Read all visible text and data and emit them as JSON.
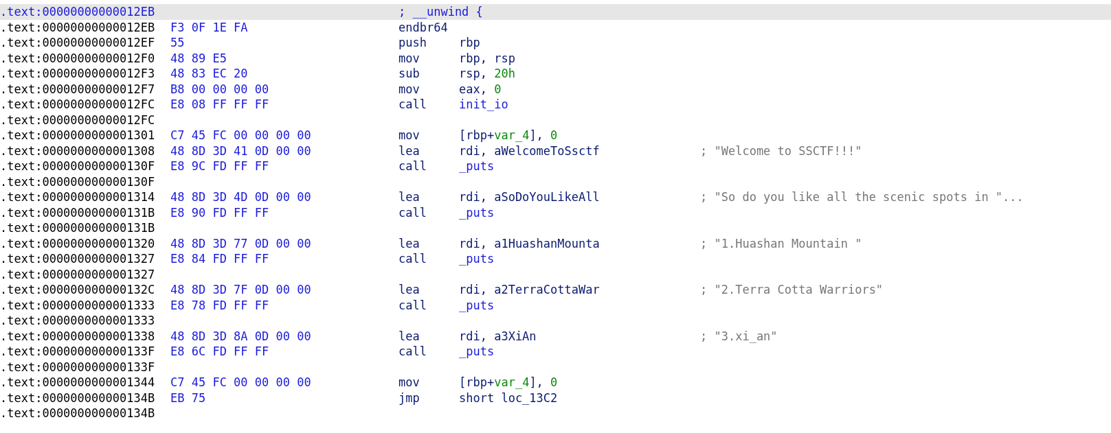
{
  "listing": [
    {
      "address": ".text:00000000000012EB",
      "selected": true,
      "directive": "; __unwind {"
    },
    {
      "address": ".text:00000000000012EB",
      "selected": false,
      "bytes": "F3 0F 1E FA",
      "mnemonic": "endbr64"
    },
    {
      "address": ".text:00000000000012EF",
      "selected": false,
      "bytes": "55",
      "mnemonic": "push",
      "operand": [
        {
          "text": "rbp",
          "kind": "plain"
        }
      ]
    },
    {
      "address": ".text:00000000000012F0",
      "selected": false,
      "bytes": "48 89 E5",
      "mnemonic": "mov",
      "operand": [
        {
          "text": "rbp, rsp",
          "kind": "plain"
        }
      ]
    },
    {
      "address": ".text:00000000000012F3",
      "selected": false,
      "bytes": "48 83 EC 20",
      "mnemonic": "sub",
      "operand": [
        {
          "text": "rsp, ",
          "kind": "plain"
        },
        {
          "text": "20h",
          "kind": "number"
        }
      ]
    },
    {
      "address": ".text:00000000000012F7",
      "selected": false,
      "bytes": "B8 00 00 00 00",
      "mnemonic": "mov",
      "operand": [
        {
          "text": "eax, ",
          "kind": "plain"
        },
        {
          "text": "0",
          "kind": "number"
        }
      ]
    },
    {
      "address": ".text:00000000000012FC",
      "selected": false,
      "bytes": "E8 08 FF FF FF",
      "mnemonic": "call",
      "operand": [
        {
          "text": "init_io",
          "kind": "name"
        }
      ]
    },
    {
      "address": ".text:00000000000012FC",
      "selected": false
    },
    {
      "address": ".text:0000000000001301",
      "selected": false,
      "bytes": "C7 45 FC 00 00 00 00",
      "mnemonic": "mov",
      "operand": [
        {
          "text": "[rbp+",
          "kind": "plain"
        },
        {
          "text": "var_4",
          "kind": "number"
        },
        {
          "text": "], ",
          "kind": "plain"
        },
        {
          "text": "0",
          "kind": "number"
        }
      ]
    },
    {
      "address": ".text:0000000000001308",
      "selected": false,
      "bytes": "48 8D 3D 41 0D 00 00",
      "mnemonic": "lea",
      "operand": [
        {
          "text": "rdi, aWelcomeToSsctf",
          "kind": "plain"
        }
      ],
      "comment": "; \"Welcome to SSCTF!!!\""
    },
    {
      "address": ".text:000000000000130F",
      "selected": false,
      "bytes": "E8 9C FD FF FF",
      "mnemonic": "call",
      "operand": [
        {
          "text": "_puts",
          "kind": "name"
        }
      ]
    },
    {
      "address": ".text:000000000000130F",
      "selected": false
    },
    {
      "address": ".text:0000000000001314",
      "selected": false,
      "bytes": "48 8D 3D 4D 0D 00 00",
      "mnemonic": "lea",
      "operand": [
        {
          "text": "rdi, aSoDoYouLikeAll",
          "kind": "plain"
        }
      ],
      "comment": "; \"So do you like all the scenic spots in \"..."
    },
    {
      "address": ".text:000000000000131B",
      "selected": false,
      "bytes": "E8 90 FD FF FF",
      "mnemonic": "call",
      "operand": [
        {
          "text": "_puts",
          "kind": "name"
        }
      ]
    },
    {
      "address": ".text:000000000000131B",
      "selected": false
    },
    {
      "address": ".text:0000000000001320",
      "selected": false,
      "bytes": "48 8D 3D 77 0D 00 00",
      "mnemonic": "lea",
      "operand": [
        {
          "text": "rdi, a1HuashanMounta",
          "kind": "plain"
        }
      ],
      "comment": "; \"1.Huashan Mountain \""
    },
    {
      "address": ".text:0000000000001327",
      "selected": false,
      "bytes": "E8 84 FD FF FF",
      "mnemonic": "call",
      "operand": [
        {
          "text": "_puts",
          "kind": "name"
        }
      ]
    },
    {
      "address": ".text:0000000000001327",
      "selected": false
    },
    {
      "address": ".text:000000000000132C",
      "selected": false,
      "bytes": "48 8D 3D 7F 0D 00 00",
      "mnemonic": "lea",
      "operand": [
        {
          "text": "rdi, a2TerraCottaWar",
          "kind": "plain"
        }
      ],
      "comment": "; \"2.Terra Cotta Warriors\""
    },
    {
      "address": ".text:0000000000001333",
      "selected": false,
      "bytes": "E8 78 FD FF FF",
      "mnemonic": "call",
      "operand": [
        {
          "text": "_puts",
          "kind": "name"
        }
      ]
    },
    {
      "address": ".text:0000000000001333",
      "selected": false
    },
    {
      "address": ".text:0000000000001338",
      "selected": false,
      "bytes": "48 8D 3D 8A 0D 00 00",
      "mnemonic": "lea",
      "operand": [
        {
          "text": "rdi, a3XiAn",
          "kind": "plain"
        }
      ],
      "comment": "; \"3.xi_an\""
    },
    {
      "address": ".text:000000000000133F",
      "selected": false,
      "bytes": "E8 6C FD FF FF",
      "mnemonic": "call",
      "operand": [
        {
          "text": "_puts",
          "kind": "name"
        }
      ]
    },
    {
      "address": ".text:000000000000133F",
      "selected": false
    },
    {
      "address": ".text:0000000000001344",
      "selected": false,
      "bytes": "C7 45 FC 00 00 00 00",
      "mnemonic": "mov",
      "operand": [
        {
          "text": "[rbp+",
          "kind": "plain"
        },
        {
          "text": "var_4",
          "kind": "number"
        },
        {
          "text": "], ",
          "kind": "plain"
        },
        {
          "text": "0",
          "kind": "number"
        }
      ]
    },
    {
      "address": ".text:000000000000134B",
      "selected": false,
      "bytes": "EB 75",
      "mnemonic": "jmp",
      "operand": [
        {
          "text": "short loc_13C2",
          "kind": "plain"
        }
      ]
    },
    {
      "address": ".text:000000000000134B",
      "selected": false
    }
  ]
}
